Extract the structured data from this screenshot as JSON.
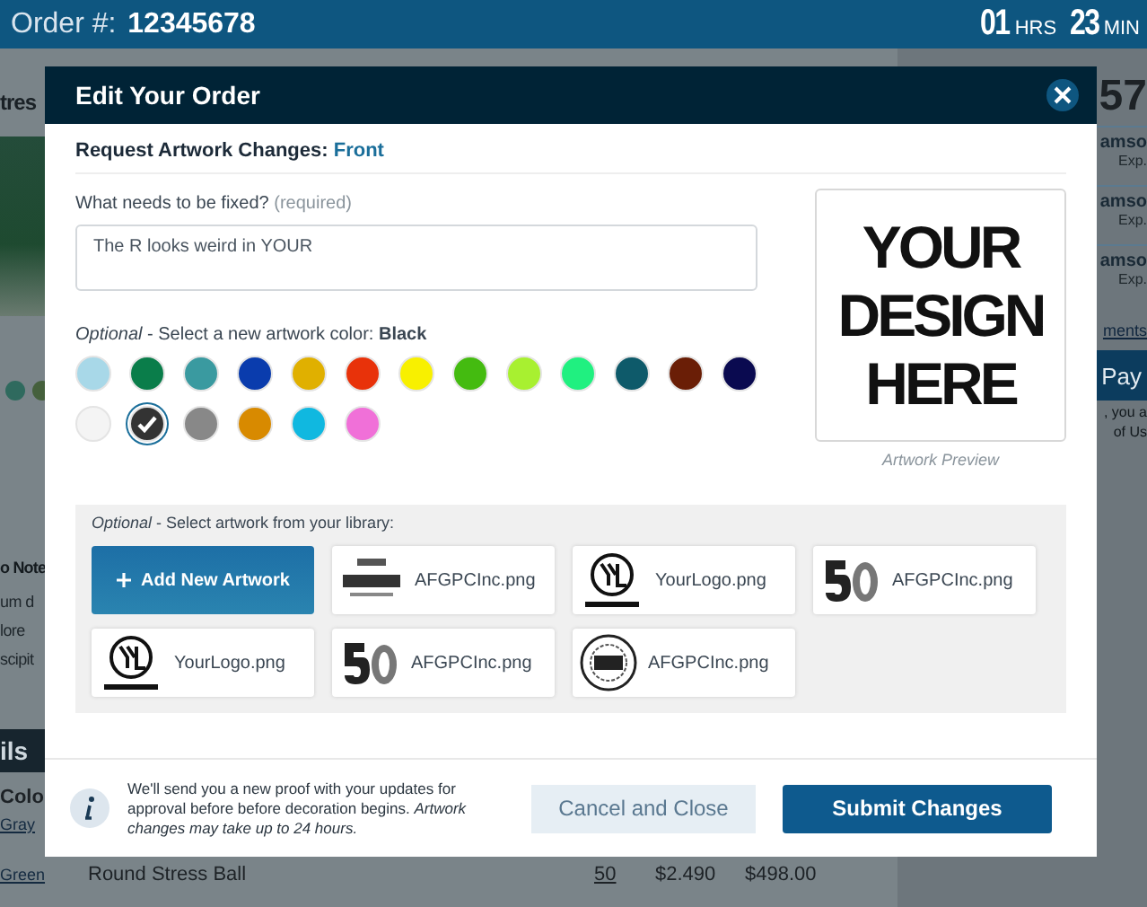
{
  "header": {
    "order_label": "Order #:",
    "order_number": "12345678",
    "countdown": [
      {
        "value": "01",
        "unit": "HRS"
      },
      {
        "value": "23",
        "unit": "MIN"
      }
    ]
  },
  "background": {
    "left_title": "tres",
    "notes": [
      "o Note",
      "um d",
      "lore",
      "scipit"
    ],
    "section_bar": "ils",
    "column_1": "Colo",
    "color_links": [
      "Gray",
      "Green"
    ],
    "row": {
      "product": "Round Stress Ball",
      "quantity": "50",
      "price": "$2.490",
      "total": "$498.00"
    },
    "right_number": "57",
    "cards": [
      {
        "name": "amso",
        "sub": "Exp."
      },
      {
        "name": "amso",
        "sub": "Exp."
      },
      {
        "name": "amso",
        "sub": "Exp."
      }
    ],
    "right_link": "ments",
    "pay_button": "Pay",
    "terms": [
      ", you a",
      "of Us"
    ]
  },
  "modal": {
    "title": "Edit Your Order",
    "section_label": "Request Artwork Changes:",
    "side": "Front",
    "field_label": "What needs to be fixed?",
    "field_hint": "(required)",
    "field_value": "The R looks weird in YOUR",
    "color_prompt": "*Optional* - Select a new artwork color: **Black**",
    "colors": [
      {
        "color": "#a8d8e8",
        "selected": false
      },
      {
        "color": "#0a7d4a",
        "selected": false
      },
      {
        "color": "#3a9aa0",
        "selected": false
      },
      {
        "color": "#0a3cad",
        "selected": false
      },
      {
        "color": "#e0b000",
        "selected": false
      },
      {
        "color": "#e8320a",
        "selected": false
      },
      {
        "color": "#f8f000",
        "selected": false
      },
      {
        "color": "#44bb10",
        "selected": false
      },
      {
        "color": "#a8f030",
        "selected": false
      },
      {
        "color": "#20f080",
        "selected": false
      },
      {
        "color": "#0e5a6a",
        "selected": false
      },
      {
        "color": "#6a1e06",
        "selected": false
      },
      {
        "color": "#0a0a50",
        "selected": false
      },
      {
        "color": "#f4f4f4",
        "selected": false
      },
      {
        "color": "#333333",
        "selected": true
      },
      {
        "color": "#888888",
        "selected": false
      },
      {
        "color": "#d88a00",
        "selected": false
      },
      {
        "color": "#10b8e0",
        "selected": false
      },
      {
        "color": "#f070d8",
        "selected": false
      }
    ],
    "preview_text": "YOUR DESIGN HERE",
    "preview_caption": "Artwork Preview",
    "library_prompt": "*Optional* - Select artwork from your library:",
    "add_button": "Add New Artwork",
    "library": [
      {
        "kind": "coffee",
        "file": "AFGPCInc.png"
      },
      {
        "kind": "monogram",
        "file": "YourLogo.png"
      },
      {
        "kind": "fifty",
        "file": "AFGPCInc.png"
      },
      {
        "kind": "monogram",
        "file": "YourLogo.png"
      },
      {
        "kind": "fifty",
        "file": "AFGPCInc.png"
      },
      {
        "kind": "seal",
        "file": "AFGPCInc.png"
      }
    ],
    "note": "We'll send you a new proof with your updates for approval before before decoration begins. *Artwork changes may take up to 24 hours.*",
    "cancel_button": "Cancel and Close",
    "submit_button": "Submit Changes"
  }
}
